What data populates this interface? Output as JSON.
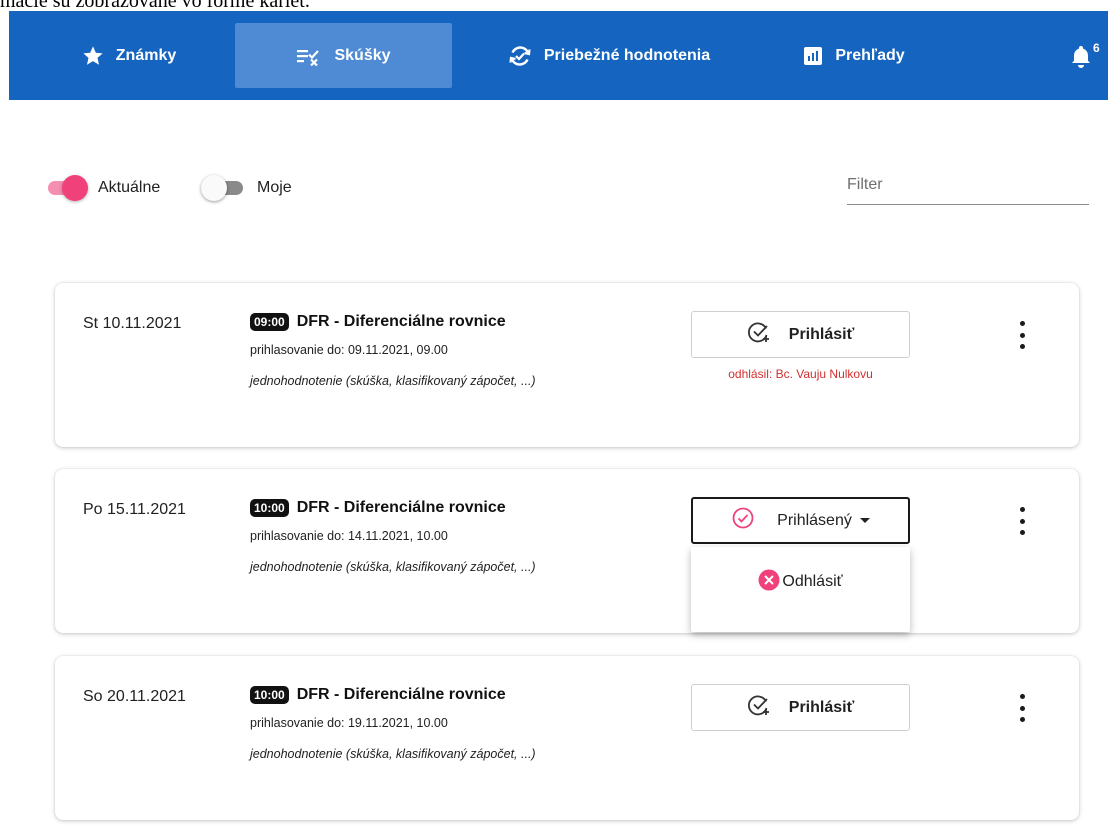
{
  "doc_caption": "mácie sú zobrazované vo forme kariet.",
  "colors": {
    "nav_bg": "#1565c0",
    "nav_active": "#4f8ad4",
    "accent_pink": "#f0417a",
    "error_red": "#d32f2f"
  },
  "nav": {
    "tabs": [
      {
        "label": "Známky",
        "icon": "star-icon",
        "active": false
      },
      {
        "label": "Skúšky",
        "icon": "checklist-icon",
        "active": true
      },
      {
        "label": "Priebežné hodnotenia",
        "icon": "refresh-check-icon",
        "active": false
      },
      {
        "label": "Prehľady",
        "icon": "bar-chart-icon",
        "active": false
      }
    ],
    "notifications": {
      "icon": "bell-icon",
      "count": "6"
    }
  },
  "filters": {
    "current": {
      "label": "Aktuálne",
      "on": true
    },
    "mine": {
      "label": "Moje",
      "on": false
    },
    "search": {
      "placeholder": "Filter",
      "value": ""
    }
  },
  "exams": [
    {
      "date": "St 10.11.2021",
      "time": "09:00",
      "title": "DFR - Diferenciálne rovnice",
      "deadline": "prihlasovanie do: 09.11.2021, 09.00",
      "description": "jednohodnotenie (skúška, klasifikovaný zápočet, ...)",
      "button_label": "Prihlásiť",
      "button_icon": "check-plus-icon",
      "note": "odhlásil: Bc. Vauju Nulkovu"
    },
    {
      "date": "Po 15.11.2021",
      "time": "10:00",
      "title": "DFR - Diferenciálne rovnice",
      "deadline": "prihlasovanie do: 14.11.2021, 10.00",
      "description": "jednohodnotenie (skúška, klasifikovaný zápočet, ...)",
      "button_label": "Prihlásený",
      "button_icon": "circle-check-icon",
      "note": ""
    },
    {
      "date": "So 20.11.2021",
      "time": "10:00",
      "title": "DFR - Diferenciálne rovnice",
      "deadline": "prihlasovanie do: 19.11.2021, 10.00",
      "description": "jednohodnotenie (skúška, klasifikovaný zápočet, ...)",
      "button_label": "Prihlásiť",
      "button_icon": "check-plus-icon",
      "note": ""
    }
  ],
  "dropdown": {
    "item_label": "Odhlásiť",
    "item_icon": "cancel-circle-icon"
  }
}
